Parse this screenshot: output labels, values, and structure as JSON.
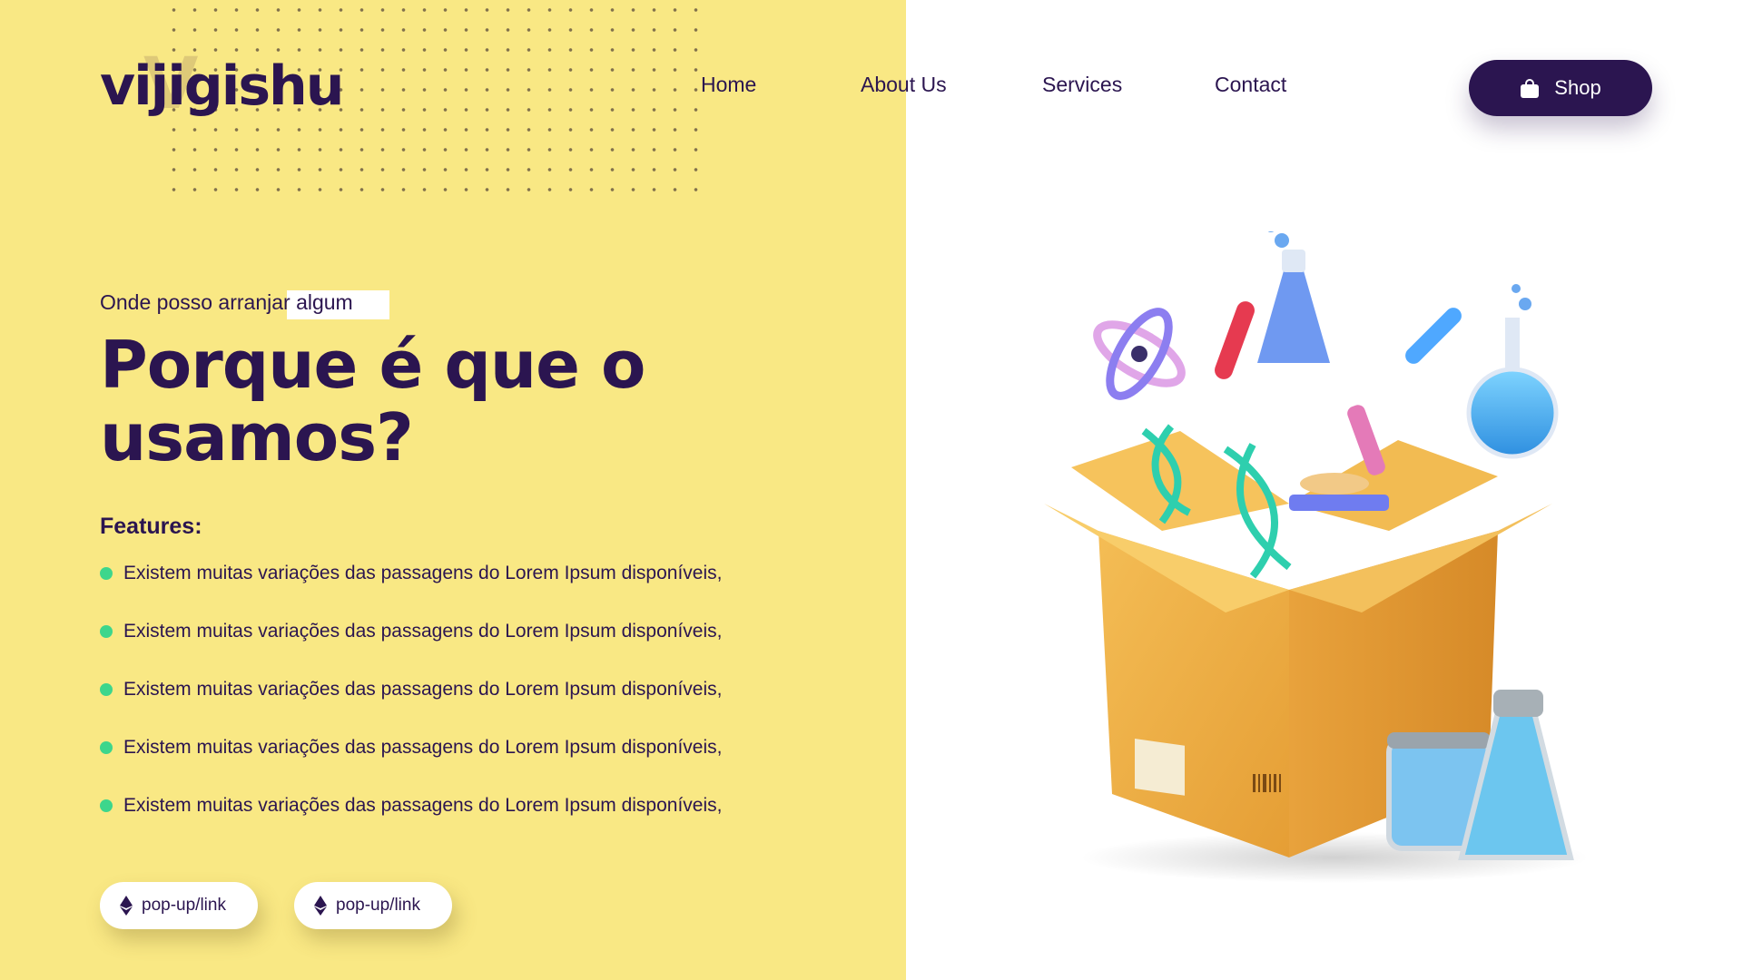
{
  "brand": {
    "logo_text": "vijigishu",
    "logo_ghost": "V"
  },
  "nav": {
    "items": [
      {
        "label": "Home"
      },
      {
        "label": "About Us"
      },
      {
        "label": "Services"
      },
      {
        "label": "Contact"
      }
    ],
    "shop_label": "Shop"
  },
  "hero": {
    "subtitle": "Onde posso arranjar algum",
    "headline_line1": "Porque é que o",
    "headline_line2": "usamos?",
    "features_title": "Features:",
    "features": [
      "Existem muitas variações das passagens do Lorem Ipsum disponíveis,",
      "Existem muitas variações das passagens do Lorem Ipsum disponíveis,",
      "Existem muitas variações das passagens do Lorem Ipsum disponíveis,",
      "Existem muitas variações das passagens do Lorem Ipsum disponíveis,",
      "Existem muitas variações das passagens do Lorem Ipsum disponíveis,"
    ],
    "buttons": [
      {
        "label": "pop-up/link",
        "icon": "ethereum-icon"
      },
      {
        "label": "pop-up/link",
        "icon": "ethereum-icon"
      }
    ]
  },
  "colors": {
    "panel": "#f9e884",
    "primary": "#2b1550",
    "bullet": "#3dd68c",
    "box": "#f0b24a"
  },
  "icons": {
    "shop": "shopping-bag-icon"
  }
}
